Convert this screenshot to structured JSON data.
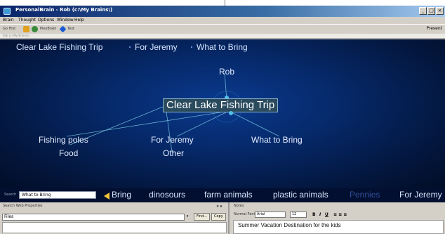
{
  "window": {
    "title": "PersonalBrain - Rob (c:\\My Brains\\)",
    "minimize": "_",
    "maximize": "□",
    "close": "×"
  },
  "menu": [
    "Brain",
    "Thought",
    "Options",
    "Window",
    "Help"
  ],
  "toolbar": {
    "back": "Go Hist",
    "plexbrain": "PlexBrain",
    "text": "Text",
    "panel": "Present"
  },
  "address": "Rob (c:\\My Brains\\)",
  "plex": {
    "breadcrumbs": [
      "Clear Lake Fishing Trip",
      "For Jeremy",
      "What to Bring"
    ],
    "parent": "Rob",
    "central": "Clear Lake Fishing Trip",
    "children": [
      "Fishing poles",
      "For Jeremy",
      "What to Bring"
    ],
    "jumps": [
      "Food",
      "Other"
    ]
  },
  "pins": {
    "search_label": "Search",
    "search_value": "What to Bring",
    "items": [
      "Bring",
      "dinosours",
      "farm animals",
      "plastic animals",
      "Pennies",
      "For Jeremy"
    ]
  },
  "left_panel": {
    "tabs": "Search  Web  Properties",
    "field": "Files",
    "find_button": "Find...",
    "copy_button": "Copy"
  },
  "right_panel": {
    "tabs": "Notes",
    "fmt_label": "Normal Font",
    "font": "Arial",
    "size": "12",
    "notes_text": "Summer Vacation Destination for the kids"
  },
  "colors": {
    "plex_bg": "#062a6c",
    "node_text": "#e4eeff",
    "link": "#7fd0e8",
    "accent_arrow": "#f2c53a"
  }
}
